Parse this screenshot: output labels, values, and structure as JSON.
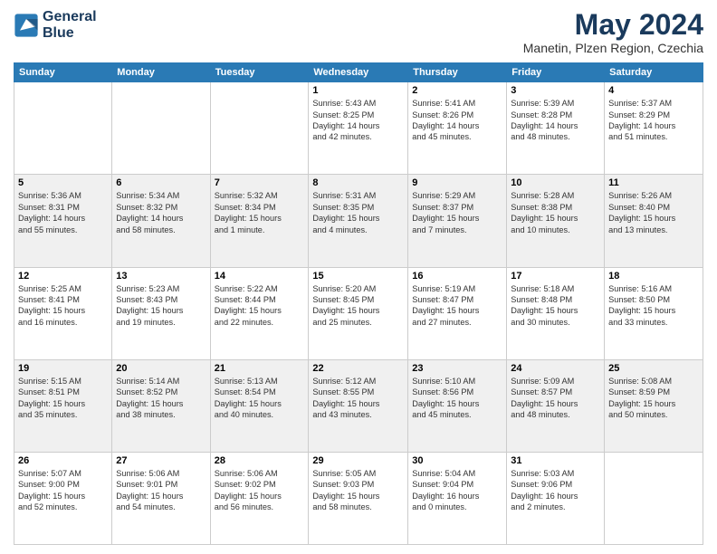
{
  "logo": {
    "line1": "General",
    "line2": "Blue"
  },
  "title": "May 2024",
  "subtitle": "Manetin, Plzen Region, Czechia",
  "days_of_week": [
    "Sunday",
    "Monday",
    "Tuesday",
    "Wednesday",
    "Thursday",
    "Friday",
    "Saturday"
  ],
  "weeks": [
    [
      {
        "day": "",
        "info": ""
      },
      {
        "day": "",
        "info": ""
      },
      {
        "day": "",
        "info": ""
      },
      {
        "day": "1",
        "info": "Sunrise: 5:43 AM\nSunset: 8:25 PM\nDaylight: 14 hours\nand 42 minutes."
      },
      {
        "day": "2",
        "info": "Sunrise: 5:41 AM\nSunset: 8:26 PM\nDaylight: 14 hours\nand 45 minutes."
      },
      {
        "day": "3",
        "info": "Sunrise: 5:39 AM\nSunset: 8:28 PM\nDaylight: 14 hours\nand 48 minutes."
      },
      {
        "day": "4",
        "info": "Sunrise: 5:37 AM\nSunset: 8:29 PM\nDaylight: 14 hours\nand 51 minutes."
      }
    ],
    [
      {
        "day": "5",
        "info": "Sunrise: 5:36 AM\nSunset: 8:31 PM\nDaylight: 14 hours\nand 55 minutes."
      },
      {
        "day": "6",
        "info": "Sunrise: 5:34 AM\nSunset: 8:32 PM\nDaylight: 14 hours\nand 58 minutes."
      },
      {
        "day": "7",
        "info": "Sunrise: 5:32 AM\nSunset: 8:34 PM\nDaylight: 15 hours\nand 1 minute."
      },
      {
        "day": "8",
        "info": "Sunrise: 5:31 AM\nSunset: 8:35 PM\nDaylight: 15 hours\nand 4 minutes."
      },
      {
        "day": "9",
        "info": "Sunrise: 5:29 AM\nSunset: 8:37 PM\nDaylight: 15 hours\nand 7 minutes."
      },
      {
        "day": "10",
        "info": "Sunrise: 5:28 AM\nSunset: 8:38 PM\nDaylight: 15 hours\nand 10 minutes."
      },
      {
        "day": "11",
        "info": "Sunrise: 5:26 AM\nSunset: 8:40 PM\nDaylight: 15 hours\nand 13 minutes."
      }
    ],
    [
      {
        "day": "12",
        "info": "Sunrise: 5:25 AM\nSunset: 8:41 PM\nDaylight: 15 hours\nand 16 minutes."
      },
      {
        "day": "13",
        "info": "Sunrise: 5:23 AM\nSunset: 8:43 PM\nDaylight: 15 hours\nand 19 minutes."
      },
      {
        "day": "14",
        "info": "Sunrise: 5:22 AM\nSunset: 8:44 PM\nDaylight: 15 hours\nand 22 minutes."
      },
      {
        "day": "15",
        "info": "Sunrise: 5:20 AM\nSunset: 8:45 PM\nDaylight: 15 hours\nand 25 minutes."
      },
      {
        "day": "16",
        "info": "Sunrise: 5:19 AM\nSunset: 8:47 PM\nDaylight: 15 hours\nand 27 minutes."
      },
      {
        "day": "17",
        "info": "Sunrise: 5:18 AM\nSunset: 8:48 PM\nDaylight: 15 hours\nand 30 minutes."
      },
      {
        "day": "18",
        "info": "Sunrise: 5:16 AM\nSunset: 8:50 PM\nDaylight: 15 hours\nand 33 minutes."
      }
    ],
    [
      {
        "day": "19",
        "info": "Sunrise: 5:15 AM\nSunset: 8:51 PM\nDaylight: 15 hours\nand 35 minutes."
      },
      {
        "day": "20",
        "info": "Sunrise: 5:14 AM\nSunset: 8:52 PM\nDaylight: 15 hours\nand 38 minutes."
      },
      {
        "day": "21",
        "info": "Sunrise: 5:13 AM\nSunset: 8:54 PM\nDaylight: 15 hours\nand 40 minutes."
      },
      {
        "day": "22",
        "info": "Sunrise: 5:12 AM\nSunset: 8:55 PM\nDaylight: 15 hours\nand 43 minutes."
      },
      {
        "day": "23",
        "info": "Sunrise: 5:10 AM\nSunset: 8:56 PM\nDaylight: 15 hours\nand 45 minutes."
      },
      {
        "day": "24",
        "info": "Sunrise: 5:09 AM\nSunset: 8:57 PM\nDaylight: 15 hours\nand 48 minutes."
      },
      {
        "day": "25",
        "info": "Sunrise: 5:08 AM\nSunset: 8:59 PM\nDaylight: 15 hours\nand 50 minutes."
      }
    ],
    [
      {
        "day": "26",
        "info": "Sunrise: 5:07 AM\nSunset: 9:00 PM\nDaylight: 15 hours\nand 52 minutes."
      },
      {
        "day": "27",
        "info": "Sunrise: 5:06 AM\nSunset: 9:01 PM\nDaylight: 15 hours\nand 54 minutes."
      },
      {
        "day": "28",
        "info": "Sunrise: 5:06 AM\nSunset: 9:02 PM\nDaylight: 15 hours\nand 56 minutes."
      },
      {
        "day": "29",
        "info": "Sunrise: 5:05 AM\nSunset: 9:03 PM\nDaylight: 15 hours\nand 58 minutes."
      },
      {
        "day": "30",
        "info": "Sunrise: 5:04 AM\nSunset: 9:04 PM\nDaylight: 16 hours\nand 0 minutes."
      },
      {
        "day": "31",
        "info": "Sunrise: 5:03 AM\nSunset: 9:06 PM\nDaylight: 16 hours\nand 2 minutes."
      },
      {
        "day": "",
        "info": ""
      }
    ]
  ]
}
